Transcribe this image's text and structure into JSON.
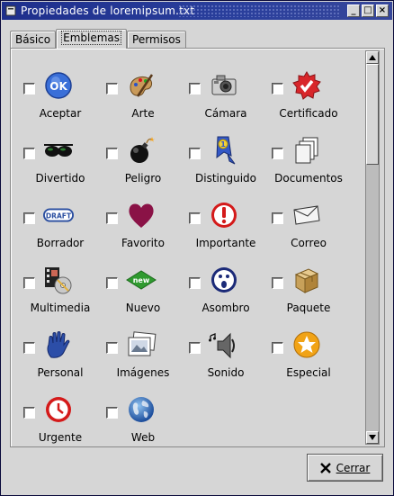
{
  "window": {
    "title": "Propiedades de loremipsum.txt",
    "buttons": [
      "_",
      "□",
      "×"
    ]
  },
  "tabs": [
    {
      "label": "Básico",
      "active": false
    },
    {
      "label": "Emblemas",
      "active": true
    },
    {
      "label": "Permisos",
      "active": false
    }
  ],
  "emblems": [
    {
      "label": "Aceptar",
      "icon": "ok-icon",
      "checked": false
    },
    {
      "label": "Arte",
      "icon": "art-palette-icon",
      "checked": false
    },
    {
      "label": "Cámara",
      "icon": "camera-icon",
      "checked": false
    },
    {
      "label": "Certificado",
      "icon": "certified-icon",
      "checked": false
    },
    {
      "label": "Divertido",
      "icon": "sunglasses-icon",
      "checked": false
    },
    {
      "label": "Peligro",
      "icon": "bomb-icon",
      "checked": false
    },
    {
      "label": "Distinguido",
      "icon": "ribbon-icon",
      "checked": false
    },
    {
      "label": "Documentos",
      "icon": "documents-icon",
      "checked": false
    },
    {
      "label": "Borrador",
      "icon": "draft-icon",
      "checked": false
    },
    {
      "label": "Favorito",
      "icon": "heart-icon",
      "checked": false
    },
    {
      "label": "Importante",
      "icon": "important-icon",
      "checked": false
    },
    {
      "label": "Correo",
      "icon": "mail-icon",
      "checked": false
    },
    {
      "label": "Multimedia",
      "icon": "multimedia-icon",
      "checked": false
    },
    {
      "label": "Nuevo",
      "icon": "new-icon",
      "checked": false
    },
    {
      "label": "Asombro",
      "icon": "surprise-icon",
      "checked": false
    },
    {
      "label": "Paquete",
      "icon": "package-icon",
      "checked": false
    },
    {
      "label": "Personal",
      "icon": "hand-icon",
      "checked": false
    },
    {
      "label": "Imágenes",
      "icon": "pictures-icon",
      "checked": false
    },
    {
      "label": "Sonido",
      "icon": "sound-icon",
      "checked": false
    },
    {
      "label": "Especial",
      "icon": "star-icon",
      "checked": false
    },
    {
      "label": "Urgente",
      "icon": "clock-icon",
      "checked": false
    },
    {
      "label": "Web",
      "icon": "globe-icon",
      "checked": false
    }
  ],
  "icon_text": {
    "ok": "OK",
    "draft": "DRAFT",
    "new": "new",
    "ribbon": "1"
  },
  "actions": {
    "close_label": "Cerrar"
  },
  "colors": {
    "titlebar": "#1e2f8c",
    "window_bg": "#d6d6d6"
  }
}
